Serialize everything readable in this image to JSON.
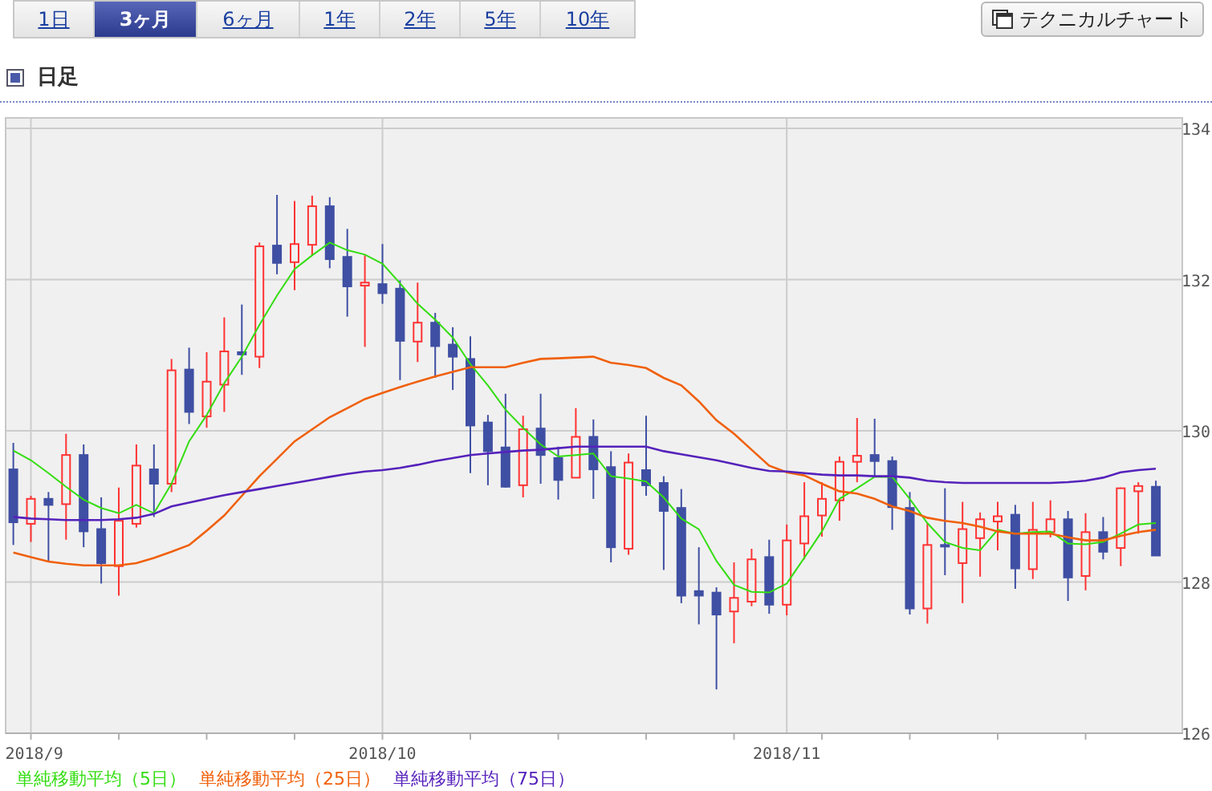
{
  "tabs": [
    {
      "label": "1日",
      "selected": false
    },
    {
      "label": "3ヶ月",
      "selected": true
    },
    {
      "label": "6ヶ月",
      "selected": false
    },
    {
      "label": "1年",
      "selected": false
    },
    {
      "label": "2年",
      "selected": false
    },
    {
      "label": "5年",
      "selected": false
    },
    {
      "label": "10年",
      "selected": false
    }
  ],
  "technical_button": {
    "label": "テクニカルチャート"
  },
  "section": {
    "title": "日足"
  },
  "chart": {
    "chart_data": {
      "type": "candlestick",
      "grid": true,
      "ylim": [
        126,
        134
      ],
      "yticks": [
        126,
        128,
        130,
        132,
        134
      ],
      "categories": [
        null,
        "2018/9",
        null,
        null,
        null,
        null,
        null,
        null,
        null,
        null,
        null,
        null,
        null,
        null,
        null,
        null,
        null,
        null,
        null,
        null,
        null,
        "2018/10",
        null,
        null,
        null,
        null,
        null,
        null,
        null,
        null,
        null,
        null,
        null,
        null,
        null,
        null,
        null,
        null,
        null,
        null,
        null,
        null,
        null,
        null,
        "2018/11",
        null,
        null,
        null,
        null,
        null,
        null,
        null,
        null,
        null,
        null,
        null,
        null,
        null,
        null,
        null,
        null,
        null,
        null,
        null,
        null,
        null
      ],
      "ohlc": [
        [
          129.49,
          129.84,
          128.49,
          128.79
        ],
        [
          128.77,
          129.14,
          128.53,
          129.1
        ],
        [
          129.1,
          129.19,
          128.28,
          129.02
        ],
        [
          129.03,
          129.96,
          128.56,
          129.68
        ],
        [
          129.68,
          129.82,
          128.46,
          128.67
        ],
        [
          128.7,
          129.12,
          127.98,
          128.25
        ],
        [
          128.21,
          129.25,
          127.82,
          128.81
        ],
        [
          128.77,
          129.82,
          128.72,
          129.54
        ],
        [
          129.49,
          129.82,
          128.86,
          129.3
        ],
        [
          129.3,
          130.95,
          129.19,
          130.8
        ],
        [
          130.81,
          131.1,
          130.09,
          130.25
        ],
        [
          130.19,
          131.04,
          130.04,
          130.65
        ],
        [
          130.61,
          131.5,
          130.25,
          131.05
        ],
        [
          131.04,
          131.67,
          130.74,
          131.01
        ],
        [
          130.98,
          132.49,
          130.83,
          132.44
        ],
        [
          132.45,
          133.12,
          132.07,
          132.22
        ],
        [
          132.23,
          133.04,
          131.86,
          132.47
        ],
        [
          132.46,
          133.11,
          132.32,
          132.97
        ],
        [
          132.97,
          133.09,
          132.15,
          132.27
        ],
        [
          132.3,
          132.67,
          131.51,
          131.91
        ],
        [
          131.92,
          132.32,
          131.11,
          131.96
        ],
        [
          131.94,
          132.47,
          131.68,
          131.82
        ],
        [
          131.88,
          131.99,
          130.67,
          131.19
        ],
        [
          131.18,
          131.96,
          130.91,
          131.43
        ],
        [
          131.43,
          131.56,
          130.7,
          131.12
        ],
        [
          131.14,
          131.37,
          130.54,
          130.98
        ],
        [
          130.95,
          131.25,
          129.44,
          130.07
        ],
        [
          130.11,
          130.21,
          129.28,
          129.73
        ],
        [
          129.78,
          130.49,
          129.25,
          129.26
        ],
        [
          129.28,
          130.2,
          129.12,
          130.02
        ],
        [
          130.03,
          130.49,
          129.3,
          129.68
        ],
        [
          129.64,
          129.79,
          129.09,
          129.35
        ],
        [
          129.38,
          130.3,
          129.38,
          129.92
        ],
        [
          129.92,
          130.15,
          129.1,
          129.49
        ],
        [
          129.52,
          129.73,
          128.26,
          128.46
        ],
        [
          128.44,
          129.7,
          128.36,
          129.58
        ],
        [
          129.48,
          130.2,
          129.14,
          129.28
        ],
        [
          129.31,
          129.4,
          128.16,
          128.94
        ],
        [
          128.98,
          129.23,
          127.72,
          127.82
        ],
        [
          127.88,
          128.46,
          127.44,
          127.82
        ],
        [
          127.86,
          127.93,
          126.58,
          127.57
        ],
        [
          127.61,
          128.26,
          127.19,
          127.79
        ],
        [
          127.74,
          128.44,
          127.68,
          128.3
        ],
        [
          128.33,
          128.56,
          127.58,
          127.7
        ],
        [
          127.7,
          128.76,
          127.56,
          128.55
        ],
        [
          128.51,
          129.32,
          128.3,
          128.87
        ],
        [
          128.88,
          129.32,
          128.6,
          129.1
        ],
        [
          129.08,
          129.66,
          128.81,
          129.59
        ],
        [
          129.59,
          130.17,
          129.32,
          129.67
        ],
        [
          129.68,
          130.16,
          129.39,
          129.6
        ],
        [
          129.6,
          129.66,
          128.69,
          128.99
        ],
        [
          128.98,
          129.19,
          127.57,
          127.65
        ],
        [
          127.65,
          128.78,
          127.45,
          128.49
        ],
        [
          128.49,
          129.24,
          128.09,
          128.47
        ],
        [
          128.25,
          129.06,
          127.72,
          128.7
        ],
        [
          128.58,
          128.92,
          128.07,
          128.83
        ],
        [
          128.8,
          129.06,
          128.42,
          128.87
        ],
        [
          128.89,
          129.02,
          127.91,
          128.18
        ],
        [
          128.17,
          129.06,
          128.04,
          128.69
        ],
        [
          128.66,
          129.08,
          128.59,
          128.83
        ],
        [
          128.83,
          128.94,
          127.75,
          128.06
        ],
        [
          128.08,
          128.91,
          127.89,
          128.66
        ],
        [
          128.66,
          128.86,
          128.3,
          128.4
        ],
        [
          128.45,
          129.25,
          128.21,
          129.24
        ],
        [
          129.2,
          129.32,
          128.64,
          129.27
        ],
        [
          129.26,
          129.34,
          128.35,
          128.35
        ]
      ],
      "series": [
        {
          "name": "単純移動平均（5日）",
          "type": "line",
          "color": "#33dd11",
          "values": [
            129.74,
            129.61,
            129.44,
            129.26,
            129.09,
            128.98,
            128.91,
            129.02,
            128.91,
            129.3,
            129.86,
            130.21,
            130.63,
            130.98,
            131.4,
            131.79,
            132.14,
            132.32,
            132.49,
            132.39,
            132.33,
            132.21,
            131.95,
            131.68,
            131.47,
            131.23,
            130.88,
            130.6,
            130.28,
            130.04,
            129.82,
            129.66,
            129.68,
            129.7,
            129.4,
            129.37,
            129.33,
            129.12,
            128.84,
            128.7,
            128.28,
            127.96,
            127.87,
            127.86,
            127.98,
            128.32,
            128.67,
            129.1,
            129.24,
            129.39,
            129.39,
            129.1,
            128.78,
            128.53,
            128.45,
            128.42,
            128.69,
            128.64,
            128.66,
            128.67,
            128.51,
            128.5,
            128.53,
            128.64,
            128.76,
            128.78
          ]
        },
        {
          "name": "単純移動平均（25日）",
          "type": "line",
          "color": "#f0600a",
          "values": [
            128.39,
            128.33,
            128.27,
            128.24,
            128.22,
            128.22,
            128.22,
            128.25,
            128.32,
            128.4,
            128.49,
            128.68,
            128.88,
            129.14,
            129.4,
            129.63,
            129.86,
            130.02,
            130.18,
            130.3,
            130.42,
            130.5,
            130.58,
            130.65,
            130.72,
            130.78,
            130.84,
            130.84,
            130.84,
            130.9,
            130.95,
            130.96,
            130.97,
            130.98,
            130.9,
            130.87,
            130.83,
            130.7,
            130.6,
            130.39,
            130.14,
            129.96,
            129.75,
            129.54,
            129.45,
            129.41,
            129.3,
            129.2,
            129.17,
            129.1,
            129.0,
            128.94,
            128.85,
            128.81,
            128.78,
            128.73,
            128.67,
            128.64,
            128.64,
            128.64,
            128.59,
            128.55,
            128.55,
            128.61,
            128.66,
            128.69
          ]
        },
        {
          "name": "単純移動平均（75日）",
          "type": "line",
          "color": "#5522bb",
          "values": [
            128.86,
            128.84,
            128.83,
            128.82,
            128.82,
            128.82,
            128.83,
            128.85,
            128.9,
            129.0,
            129.05,
            129.1,
            129.15,
            129.19,
            129.23,
            129.27,
            129.31,
            129.35,
            129.39,
            129.43,
            129.46,
            129.48,
            129.51,
            129.55,
            129.6,
            129.64,
            129.68,
            129.7,
            129.72,
            129.74,
            129.75,
            129.77,
            129.79,
            129.79,
            129.79,
            129.79,
            129.79,
            129.73,
            129.69,
            129.65,
            129.61,
            129.56,
            129.51,
            129.47,
            129.46,
            129.44,
            129.42,
            129.41,
            129.41,
            129.4,
            129.4,
            129.38,
            129.34,
            129.32,
            129.31,
            129.31,
            129.31,
            129.31,
            129.31,
            129.31,
            129.32,
            129.34,
            129.38,
            129.45,
            129.48,
            129.5
          ]
        }
      ]
    }
  }
}
